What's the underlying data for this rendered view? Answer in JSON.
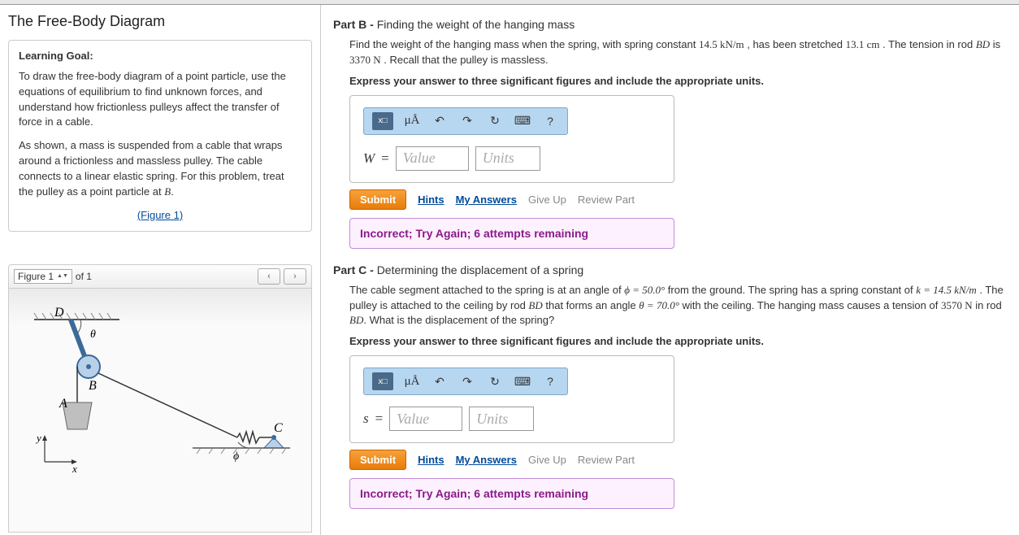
{
  "left": {
    "title": "The Free-Body Diagram",
    "learning_goal_label": "Learning Goal:",
    "goal_text": "To draw the free-body diagram of a point particle, use the equations of equilibrium to find unknown forces, and understand how frictionless pulleys affect the transfer of force in a cable.",
    "scenario_text_pre": "As shown, a mass is suspended from a cable that wraps around a frictionless and massless pulley. The cable connects to a linear elastic spring. For this problem, treat the pulley as a point particle at ",
    "scenario_point": "B",
    "figure_link": "(Figure 1)",
    "fig_selector": "Figure 1",
    "fig_of": "of 1"
  },
  "toolbar": {
    "templates": "x□",
    "special": "μÅ",
    "undo": "↶",
    "redo": "↷",
    "reset": "↻",
    "keyboard": "⌨",
    "help": "?"
  },
  "inputs": {
    "value_ph": "Value",
    "units_ph": "Units"
  },
  "actions": {
    "submit": "Submit",
    "hints": "Hints",
    "my_answers": "My Answers",
    "give_up": "Give Up",
    "review": "Review Part"
  },
  "partB": {
    "label": "Part B - ",
    "subtitle": "Finding the weight of the hanging mass",
    "q_a": "Find the weight of the hanging mass when the spring, with spring constant ",
    "k_val": "14.5 kN/m",
    "q_b": " , has been stretched ",
    "stretch": "13.1 cm",
    "q_c": " . The tension in rod ",
    "rod": "BD",
    "q_d": " is ",
    "tension": "3370 N",
    "q_e": " . Recall that the pulley is massless.",
    "instr": "Express your answer to three significant figures and include the appropriate units.",
    "var": "W",
    "feedback": "Incorrect; Try Again; 6 attempts remaining"
  },
  "partC": {
    "label": "Part C - ",
    "subtitle": "Determining the displacement of a spring",
    "q_a": "The cable segment attached to the spring is at an angle of ",
    "phi": "ϕ = 50.0°",
    "q_b": " from the ground. The spring has a spring constant of ",
    "k_val": "k = 14.5 kN/m",
    "q_c": " . The pulley is attached to the ceiling by rod ",
    "rod": "BD",
    "q_d": " that forms an angle ",
    "theta": "θ = 70.0°",
    "q_e": " with the ceiling. The hanging mass causes a tension of ",
    "tension": "3570 N",
    "q_f": " in rod ",
    "q_g": ". What is the displacement of the spring?",
    "instr": "Express your answer to three significant figures and include the appropriate units.",
    "var": "s",
    "feedback": "Incorrect; Try Again; 6 attempts remaining"
  }
}
